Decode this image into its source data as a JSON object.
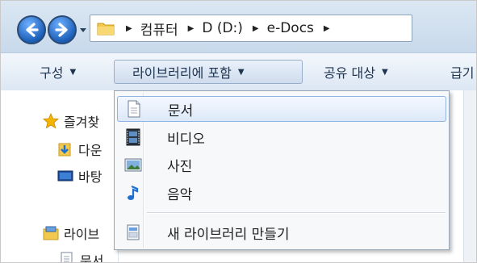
{
  "address": {
    "crumbs": [
      {
        "label": "컴퓨터"
      },
      {
        "label": "D (D:)"
      },
      {
        "label": "e-Docs"
      }
    ]
  },
  "toolbar": {
    "organize": "구성",
    "include_in_library": "라이브러리에 포함",
    "share_with": "공유 대상",
    "new_folder_partial": "급기"
  },
  "navpane": {
    "favorites": "즐겨찾",
    "downloads": "다운",
    "desktop": "바탕",
    "libraries": "라이브",
    "documents": "문서"
  },
  "menu": {
    "items": [
      {
        "label": "문서",
        "icon": "document-library-icon",
        "highlighted": true
      },
      {
        "label": "비디오",
        "icon": "video-library-icon"
      },
      {
        "label": "사진",
        "icon": "pictures-library-icon"
      },
      {
        "label": "음악",
        "icon": "music-library-icon"
      }
    ],
    "new_library": {
      "label": "새 라이브러리 만들기",
      "icon": "new-library-icon"
    }
  },
  "colors": {
    "accent": "#1c5fb8",
    "toolbar_text": "#1e3350",
    "highlight_border": "#8db2e3"
  }
}
